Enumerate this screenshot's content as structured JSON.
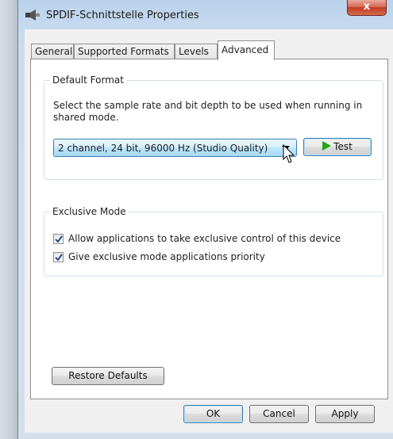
{
  "window": {
    "title": "SPDIF-Schnittstelle Properties",
    "close_glyph": "x"
  },
  "tabs": [
    {
      "label": "General"
    },
    {
      "label": "Supported Formats"
    },
    {
      "label": "Levels"
    },
    {
      "label": "Advanced",
      "active": true
    }
  ],
  "default_format": {
    "legend": "Default Format",
    "description": "Select the sample rate and bit depth to be used when running in shared mode.",
    "selected_format": "2 channel, 24 bit, 96000 Hz (Studio Quality)",
    "test_label": "Test"
  },
  "exclusive_mode": {
    "legend": "Exclusive Mode",
    "options": [
      {
        "label": "Allow applications to take exclusive control of this device",
        "checked": true
      },
      {
        "label": "Give exclusive mode applications priority",
        "checked": true
      }
    ]
  },
  "restore_defaults_label": "Restore Defaults",
  "footer": {
    "ok_label": "OK",
    "cancel_label": "Cancel",
    "apply_label": "Apply"
  },
  "icons": {
    "app": "speaker-icon",
    "close": "close-icon",
    "dropdown": "chevron-down-icon",
    "test": "play-icon",
    "cursor": "mouse-cursor-icon"
  },
  "colors": {
    "play_green": "#27a314",
    "close_red": "#c23d23",
    "focus_blue": "#3c7fb1"
  }
}
